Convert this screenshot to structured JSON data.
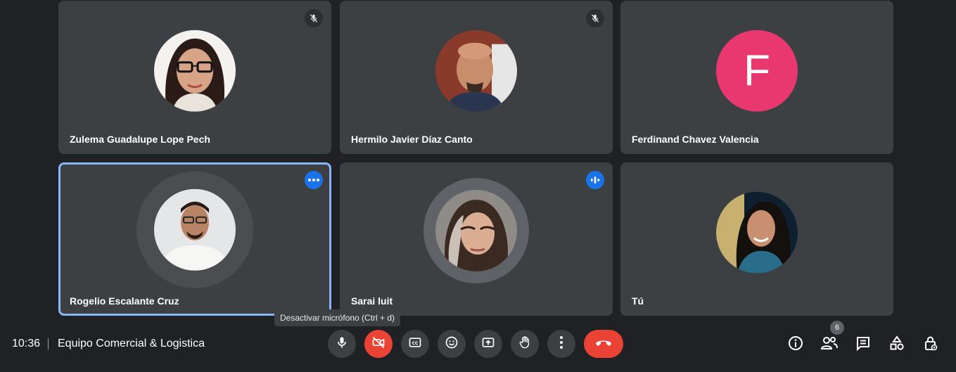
{
  "participants": [
    {
      "name": "Zulema Guadalupe Lope Pech",
      "muted": true
    },
    {
      "name": "Hermilo Javier Díaz Canto",
      "muted": true
    },
    {
      "name": "Ferdinand Chavez Valencia",
      "initial": "F",
      "avatar_color": "#e8386f"
    },
    {
      "name": "Rogelio Escalante Cruz",
      "active": true
    },
    {
      "name": "Sarai luit",
      "speaking": true
    },
    {
      "name": "Tú"
    }
  ],
  "bottom_bar": {
    "time": "10:36",
    "meeting_title": "Equipo Comercial & Logistica",
    "tooltip": "Desactivar micrófono (Ctrl + d)",
    "people_count": "6"
  },
  "colors": {
    "background": "#202124",
    "tile": "#3c4043",
    "accent": "#8ab4f8",
    "danger": "#ea4335",
    "blue": "#1a73e8"
  },
  "icons": {
    "mic": "mic-icon",
    "camera_off": "videocam-off-icon",
    "captions": "closed-captions-icon",
    "emoji": "emoji-icon",
    "present": "present-screen-icon",
    "hand": "raise-hand-icon",
    "more": "more-vert-icon",
    "hangup": "call-end-icon",
    "info": "info-icon",
    "people": "people-icon",
    "chat": "chat-icon",
    "activities": "activities-icon",
    "host": "host-controls-icon"
  }
}
